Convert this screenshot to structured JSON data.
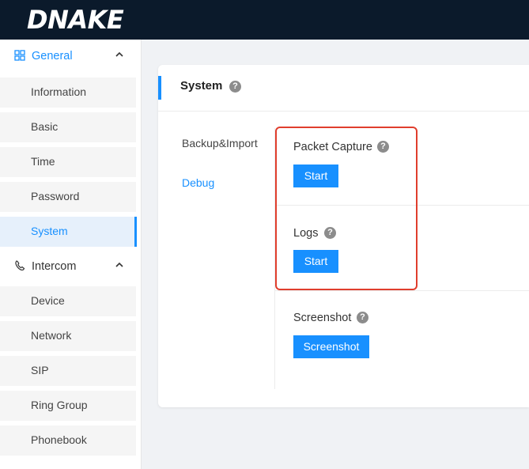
{
  "brand": {
    "logo_text": "DNAKE"
  },
  "sidebar": {
    "groups": [
      {
        "label": "General",
        "items": [
          "Information",
          "Basic",
          "Time",
          "Password",
          "System"
        ]
      },
      {
        "label": "Intercom",
        "items": [
          "Device",
          "Network",
          "SIP",
          "Ring Group",
          "Phonebook"
        ]
      }
    ],
    "active_item": "System"
  },
  "card": {
    "title": "System",
    "tabs": [
      "Backup&Import",
      "Debug"
    ],
    "active_tab": "Debug",
    "sections": [
      {
        "label": "Packet Capture",
        "button": "Start"
      },
      {
        "label": "Logs",
        "button": "Start"
      },
      {
        "label": "Screenshot",
        "button": "Screenshot"
      }
    ]
  },
  "colors": {
    "accent": "#1890ff",
    "topbar": "#0b1a2b",
    "highlight": "#e03e2d"
  }
}
